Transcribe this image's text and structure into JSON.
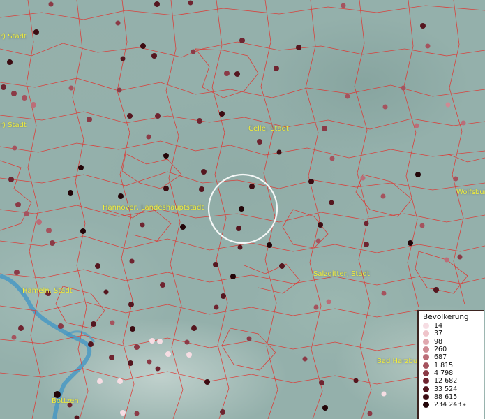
{
  "map": {
    "cities": [
      {
        "id": "city-label-top-left",
        "label": "r) Stadt"
      },
      {
        "id": "city-label-left",
        "label": "r) Stadt"
      },
      {
        "id": "city-label-celle",
        "label": "Celle, Stadt"
      },
      {
        "id": "city-label-wolfsburg",
        "label": "Wolfsbur"
      },
      {
        "id": "city-label-hannover",
        "label": "Hannover, Landeshauptstadt"
      },
      {
        "id": "city-label-salzgitter",
        "label": "Salzgitter, Stadt"
      },
      {
        "id": "city-label-hameln",
        "label": "Hameln, Stadt"
      },
      {
        "id": "city-label-bad-harzburg",
        "label": "Bad Harzbu"
      },
      {
        "id": "city-label-bottrop",
        "label": "Bottzen"
      }
    ]
  },
  "legend": {
    "title": "Bevölkerung",
    "items": [
      {
        "label": "14",
        "color": "#f6dde3"
      },
      {
        "label": "37",
        "color": "#efc4ca"
      },
      {
        "label": "98",
        "color": "#e0a8af"
      },
      {
        "label": "260",
        "color": "#cf8a93"
      },
      {
        "label": "687",
        "color": "#bb6d78"
      },
      {
        "label": "1 815",
        "color": "#a5535e"
      },
      {
        "label": "4 798",
        "color": "#8b3a46"
      },
      {
        "label": "12 682",
        "color": "#6f2430"
      },
      {
        "label": "33 524",
        "color": "#55161f"
      },
      {
        "label": "88 615",
        "color": "#3c0c12"
      },
      {
        "label": "234 243",
        "color": "#230508",
        "plus": "+"
      }
    ]
  }
}
